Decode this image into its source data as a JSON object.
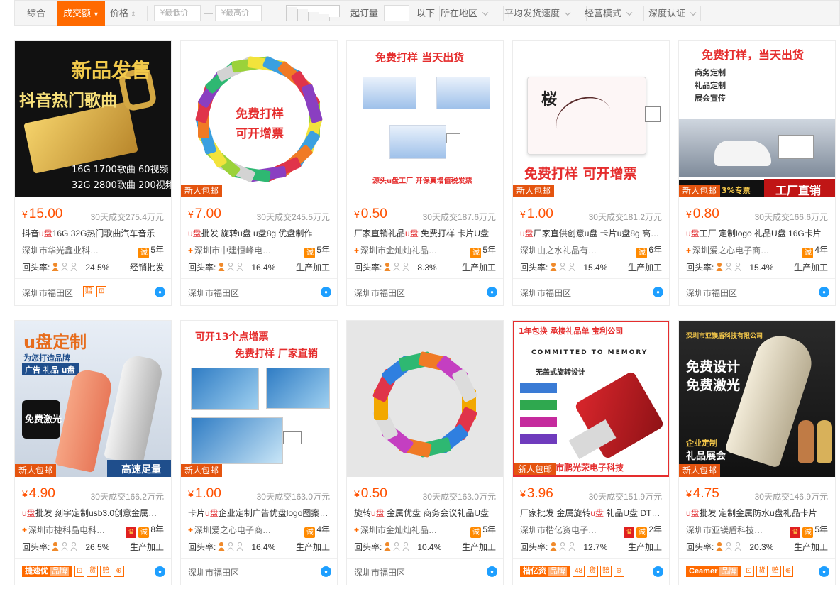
{
  "filter": {
    "sort_all": "综合",
    "sort_volume": "成交额",
    "sort_price": "价格",
    "price_min_placeholder": "¥最低价",
    "price_max_placeholder": "¥最高价",
    "price_dash": "—",
    "moq_label": "起订量",
    "moq_suffix": "以下",
    "region": "所在地区",
    "ship_speed": "平均发货速度",
    "biz_mode": "经营模式",
    "depth_cert": "深度认证"
  },
  "labels": {
    "repeat": "回头率:",
    "new_tag": "新人包邮",
    "yen": "¥"
  },
  "thumb_text": {
    "p1_a": "新品发售",
    "p1_b": "抖音热门歌曲",
    "p1_c": "16G 1700歌曲 60视频",
    "p1_d": "32G 2800歌曲 200视频",
    "p2_a": "免费打样",
    "p2_b": "可开增票",
    "p3_a": "免费打样  当天出货",
    "p3_b": "源头u盘工厂  开保真增值税发票",
    "p4_a": "桜",
    "p4_b": "免费打样 可开增票",
    "p5_a": "免费打样，当天出货",
    "p5_b": "商务定制",
    "p5_c": "礼品定制",
    "p5_d": "展会宣传",
    "p5_e": "工厂直销",
    "p5_f": "3%专票",
    "p6_a": "u盘定制",
    "p6_b": "为您打造品牌",
    "p6_c": "广告 礼品 u盘",
    "p6_d": "免费激光",
    "p6_e": "高速足量",
    "p7_a": "可开13个点增票",
    "p7_b": "免费打样  厂家直销",
    "p9_a": "1年包换   承接礼品单   宝利公司",
    "p9_b": "COMMITTED TO MEMORY",
    "p9_c": "无盖式旋转设计",
    "p9_d": "深圳市鹏光荣电子科技",
    "p10_a": "深圳市亚镁盾科技有限公司",
    "p10_b": "免费设计",
    "p10_c": "免费激光",
    "p10_d": "企业定制",
    "p10_e": "礼品展会"
  },
  "products": [
    {
      "price": "15.00",
      "sold": "30天成交275.4万元",
      "title_pre": "抖音",
      "title_hl": "u盘",
      "title_post": "16G 32G热门歌曲汽车音乐",
      "shop": "深圳市华光鑫业科…",
      "plus": false,
      "crown": false,
      "years": "5年",
      "repeat": "24.5%",
      "biz": "经销批发",
      "loc": "深圳市福田区",
      "new": false,
      "badges": [
        "赔",
        "⊡"
      ],
      "brand": ""
    },
    {
      "price": "7.00",
      "sold": "30天成交245.5万元",
      "title_pre": "",
      "title_hl": "u盘",
      "title_post": "批发 旋转u盘 u盘8g 优盘制作",
      "shop": "深圳市中建恒峰电…",
      "plus": true,
      "crown": false,
      "years": "5年",
      "repeat": "16.4%",
      "biz": "生产加工",
      "loc": "深圳市福田区",
      "new": true,
      "badges": [],
      "brand": ""
    },
    {
      "price": "0.50",
      "sold": "30天成交187.6万元",
      "title_pre": "厂家直销礼品",
      "title_hl": "u盘",
      "title_post": " 免费打样 卡片U盘",
      "shop": "深圳市金灿灿礼品…",
      "plus": true,
      "crown": false,
      "years": "5年",
      "repeat": "8.3%",
      "biz": "生产加工",
      "loc": "深圳市福田区",
      "new": false,
      "badges": [],
      "brand": ""
    },
    {
      "price": "1.00",
      "sold": "30天成交181.2万元",
      "title_pre": "",
      "title_hl": "u盘",
      "title_post": "厂家直供创意u盘 卡片u盘8g 高…",
      "shop": "深圳山之水礼品有…",
      "plus": false,
      "crown": false,
      "years": "6年",
      "repeat": "15.4%",
      "biz": "生产加工",
      "loc": "深圳市福田区",
      "new": true,
      "badges": [],
      "brand": ""
    },
    {
      "price": "0.80",
      "sold": "30天成交166.6万元",
      "title_pre": "",
      "title_hl": "u盘",
      "title_post": "工厂 定制logo 礼品U盘 16G卡片",
      "shop": "深圳爱之心电子商…",
      "plus": true,
      "crown": false,
      "years": "4年",
      "repeat": "15.4%",
      "biz": "生产加工",
      "loc": "深圳市福田区",
      "new": true,
      "badges": [],
      "brand": ""
    },
    {
      "price": "4.90",
      "sold": "30天成交166.2万元",
      "title_pre": "",
      "title_hl": "u盘",
      "title_post": "批发 刻字定制usb3.0创意金属优…",
      "shop": "深圳市捷科晶电科…",
      "plus": true,
      "crown": true,
      "years": "8年",
      "repeat": "26.5%",
      "biz": "生产加工",
      "loc": "",
      "new": true,
      "badges": [
        "⊡",
        "货",
        "赔",
        "⊕"
      ],
      "brand": "捷速优"
    },
    {
      "price": "1.00",
      "sold": "30天成交163.0万元",
      "title_pre": "卡片",
      "title_hl": "u盘",
      "title_post": "企业定制广告优盘logo图案…",
      "shop": "深圳爱之心电子商…",
      "plus": true,
      "crown": false,
      "years": "4年",
      "repeat": "16.4%",
      "biz": "生产加工",
      "loc": "深圳市福田区",
      "new": true,
      "badges": [],
      "brand": ""
    },
    {
      "price": "0.50",
      "sold": "30天成交163.0万元",
      "title_pre": "旋转",
      "title_hl": "u盘",
      "title_post": " 金属优盘 商务会议礼品U盘",
      "shop": "深圳市金灿灿礼品…",
      "plus": true,
      "crown": false,
      "years": "5年",
      "repeat": "10.4%",
      "biz": "生产加工",
      "loc": "深圳市福田区",
      "new": false,
      "badges": [],
      "brand": ""
    },
    {
      "price": "3.96",
      "sold": "30天成交151.9万元",
      "title_pre": "厂家批发 金属旋转",
      "title_hl": "u盘",
      "title_post": " 礼品U盘 DT…",
      "shop": "深圳市楷亿资电子…",
      "plus": false,
      "crown": true,
      "years": "2年",
      "repeat": "12.7%",
      "biz": "生产加工",
      "loc": "",
      "new": true,
      "badges": [
        "48",
        "货",
        "赔",
        "⊕"
      ],
      "brand": "楷亿资"
    },
    {
      "price": "4.75",
      "sold": "30天成交146.9万元",
      "title_pre": "",
      "title_hl": "u盘",
      "title_post": "批发 定制金属防水u盘礼品卡片",
      "shop": "深圳市亚镁盾科技…",
      "plus": false,
      "crown": true,
      "years": "5年",
      "repeat": "20.3%",
      "biz": "生产加工",
      "loc": "",
      "new": true,
      "badges": [
        "⊡",
        "货",
        "赔",
        "⊕"
      ],
      "brand": "Ceamer"
    }
  ],
  "brand_suffix": "品牌",
  "colors": {
    "accent": "#ff6a00",
    "price": "#ff5000",
    "highlight": "#e4393c"
  }
}
